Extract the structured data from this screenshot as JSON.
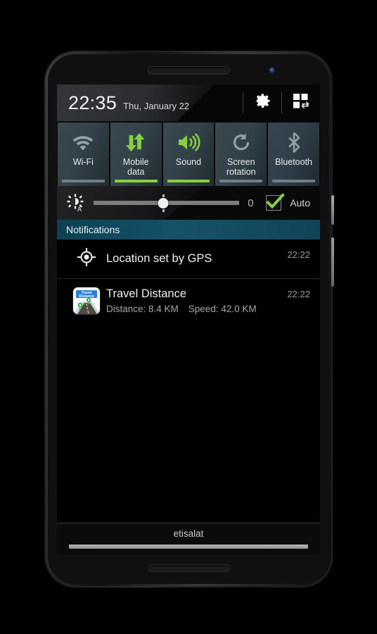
{
  "statusbar": {
    "time": "22:35",
    "date": "Thu, January 22",
    "settings_icon": "gear-icon",
    "edit_toggles_icon": "grid-swap-icon"
  },
  "quick_toggles": [
    {
      "label": "Wi-Fi",
      "icon": "wifi-icon",
      "active": false
    },
    {
      "label": "Mobile\ndata",
      "label_line1": "Mobile",
      "label_line2": "data",
      "icon": "mobile-data-icon",
      "active": true
    },
    {
      "label": "Sound",
      "icon": "sound-icon",
      "active": true
    },
    {
      "label": "Screen\nrotation",
      "label_line1": "Screen",
      "label_line2": "rotation",
      "icon": "screen-rotation-icon",
      "active": false
    },
    {
      "label": "Bluetooth",
      "icon": "bluetooth-icon",
      "active": false
    }
  ],
  "brightness": {
    "icon": "auto-brightness-icon",
    "slider_percent": 48,
    "value": "0",
    "auto_label": "Auto",
    "auto_checked": true
  },
  "notifications": {
    "header": "Notifications",
    "items": [
      {
        "icon": "gps-location-icon",
        "title": "Location set by GPS",
        "subtitle": "",
        "time": "22:22"
      },
      {
        "icon": "travel-distance-app-icon",
        "title": "Travel Distance",
        "detail_distance": "Distance: 8.4 KM",
        "detail_speed": "Speed: 42.0 KM",
        "time": "22:22"
      }
    ]
  },
  "footer": {
    "carrier": "etisalat"
  },
  "colors": {
    "accent_green": "#86cf3e",
    "notif_header_teal": "#16516a",
    "tile_bg": "#2f3f46",
    "inactive_gray": "#93a1a8"
  }
}
